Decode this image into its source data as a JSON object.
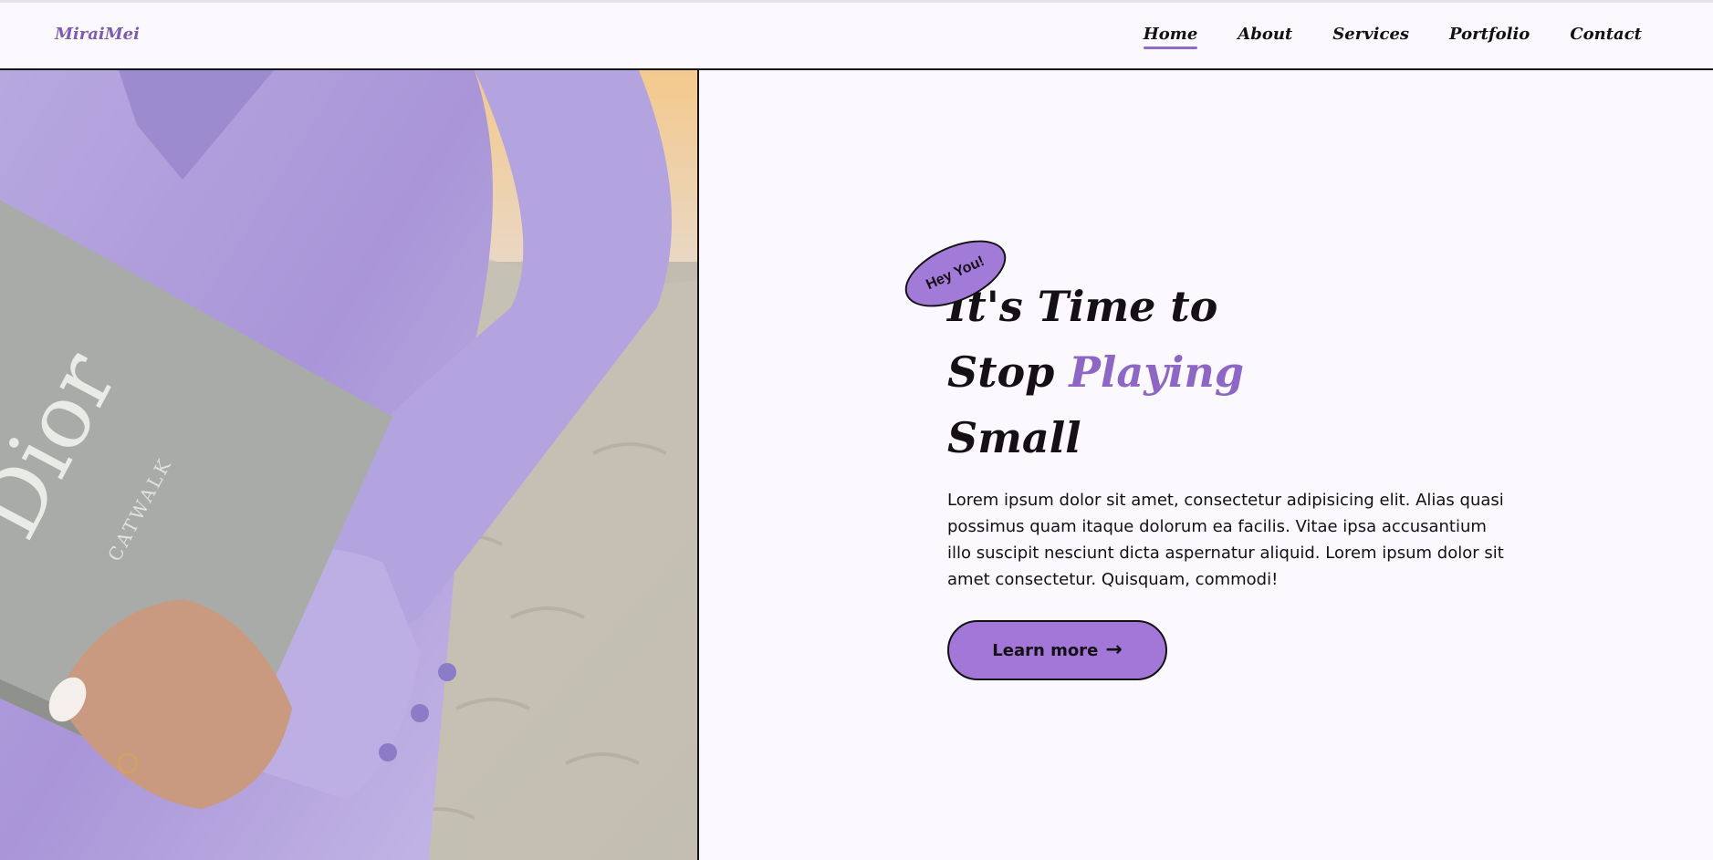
{
  "brand": {
    "logo": "MiraiMei",
    "accent_color": "#8e66c6",
    "button_color": "#a277d8"
  },
  "nav": {
    "items": [
      {
        "label": "Home",
        "active": true
      },
      {
        "label": "About",
        "active": false
      },
      {
        "label": "Services",
        "active": false
      },
      {
        "label": "Portfolio",
        "active": false
      },
      {
        "label": "Contact",
        "active": false
      }
    ]
  },
  "hero": {
    "badge": "Hey You!",
    "title_line1": "It's Time to",
    "title_line2_plain": "Stop",
    "title_line2_accent": "Playing",
    "title_line3": "Small",
    "description": "Lorem ipsum dolor sit amet, consectetur adipisicing elit. Alias quasi possimus quam itaque dolorum ea facilis. Vitae ipsa accusantium illo suscipit nesciunt dicta aspernatur aliquid. Lorem ipsum dolor sit amet consectetur. Quisquam, commodi!",
    "cta_label": "Learn more",
    "cta_icon": "arrow-right-icon"
  },
  "photo": {
    "book_title": "Dior",
    "book_subtitle": "CATWALK"
  }
}
